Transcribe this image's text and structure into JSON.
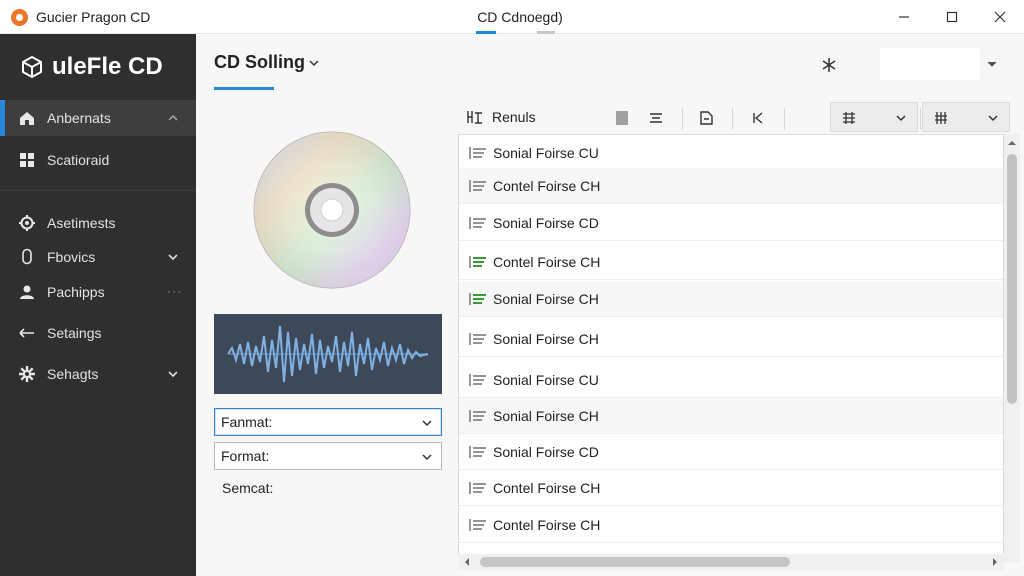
{
  "window": {
    "app_title": "Gucier Pragon CD",
    "title": "CD Cdnoegd)",
    "controls": {
      "minimize": "—",
      "maximize": "☐",
      "close": "✕"
    }
  },
  "sidebar": {
    "brand": "uleFle CD",
    "items": [
      {
        "label": "Anbernats",
        "icon": "home-icon",
        "active": true,
        "chevron": "up"
      },
      {
        "label": "Scatioraid",
        "icon": "grid-icon"
      },
      {
        "label": "Asetimests",
        "icon": "gear-icon"
      },
      {
        "label": "Fbovics",
        "icon": "microphone-icon",
        "chevron": "down"
      },
      {
        "label": "Pachipps",
        "icon": "person-icon",
        "dots": "···"
      },
      {
        "label": "Setaings",
        "icon": "arrows-icon"
      },
      {
        "label": "Sehagts",
        "icon": "settings-icon",
        "chevron": "down"
      }
    ]
  },
  "header": {
    "title": "CD Solling",
    "tool_icon": "snowflake-icon",
    "search_placeholder": ""
  },
  "left_panel": {
    "cd_icon": "cd-disc-icon",
    "waveform_icon": "waveform-icon",
    "format_select_1": "Fanmat:",
    "format_select_2": "Format:",
    "semcat_label": "Semcat:"
  },
  "toolbar": {
    "results_label": "Renuls",
    "buttons": [
      "align-icon",
      "tag-icon",
      "chevron-left-icon"
    ],
    "combos": [
      "filter-icon",
      "columns-icon"
    ]
  },
  "list": {
    "rows": [
      {
        "label": "Sonial Foirse CU",
        "icon": "list-icon"
      },
      {
        "label": "Contel Foirse CH",
        "icon": "list-icon"
      },
      {
        "label": "Sonial Foirse CD",
        "icon": "list-icon"
      },
      {
        "label": "Contel Foirse CH",
        "icon": "list-green-icon"
      },
      {
        "label": "Sonial Foirse CH",
        "icon": "list-green-icon"
      },
      {
        "label": "Sonial Foirse CH",
        "icon": "list-icon"
      },
      {
        "label": "Sonial Foirse CU",
        "icon": "list-icon"
      },
      {
        "label": "Sonial Foirse CH",
        "icon": "list-icon"
      },
      {
        "label": "Sonial Foirse CD",
        "icon": "list-icon"
      },
      {
        "label": "Contel Foirse CH",
        "icon": "list-icon"
      },
      {
        "label": "Contel Foirse CH",
        "icon": "list-icon"
      }
    ]
  },
  "colors": {
    "accent": "#2a8ad9",
    "sidebar": "#2f2f2f",
    "green_icon": "#3a9a3a"
  }
}
